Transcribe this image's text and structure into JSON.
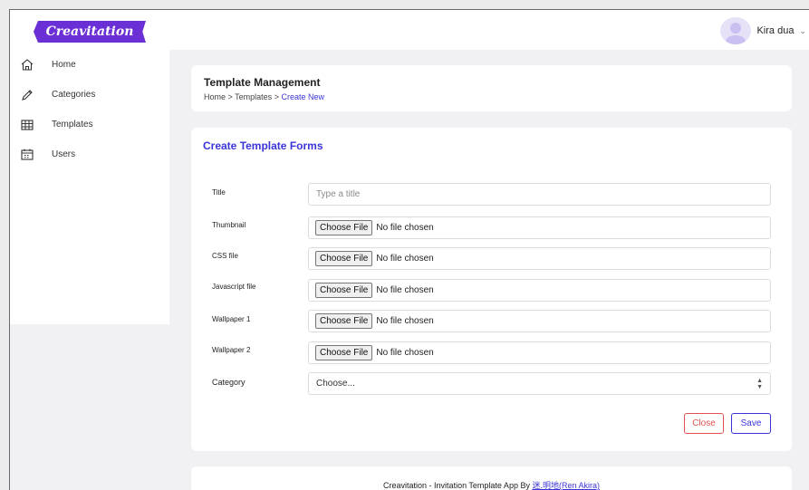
{
  "app": {
    "logo_text": "Creavitation",
    "brand_color": "#6b2fd6",
    "accent_color": "#3b34d8",
    "danger_color": "#e05252"
  },
  "user": {
    "name": "Kira dua",
    "menu_icon": "chevron-down-icon"
  },
  "sidebar": {
    "items": [
      {
        "label": "Home",
        "icon": "home-icon"
      },
      {
        "label": "Categories",
        "icon": "pencil-icon"
      },
      {
        "label": "Templates",
        "icon": "table-icon"
      },
      {
        "label": "Users",
        "icon": "calendar-icon"
      }
    ]
  },
  "header": {
    "title": "Template Management",
    "breadcrumb": {
      "home": "Home",
      "sep1": ">",
      "templates": "Templates",
      "sep2": ">",
      "current": "Create New"
    }
  },
  "form": {
    "title": "Create Template Forms",
    "title_field": {
      "label": "Title",
      "placeholder": "Type a title",
      "value": ""
    },
    "file_fields": [
      {
        "label": "Thumbnail",
        "button": "Choose File",
        "status": "No file chosen"
      },
      {
        "label": "CSS file",
        "button": "Choose File",
        "status": "No file chosen"
      },
      {
        "label": "Javascript file",
        "button": "Choose File",
        "status": "No file chosen"
      },
      {
        "label": "Wallpaper 1",
        "button": "Choose File",
        "status": "No file chosen"
      },
      {
        "label": "Wallpaper 2",
        "button": "Choose File",
        "status": "No file chosen"
      }
    ],
    "category": {
      "label": "Category",
      "selected": "Choose..."
    },
    "close_label": "Close",
    "save_label": "Save"
  },
  "footer": {
    "text": "Creavitation - Invitation Template App By ",
    "link": "迷.明地(Ren Akira)"
  }
}
